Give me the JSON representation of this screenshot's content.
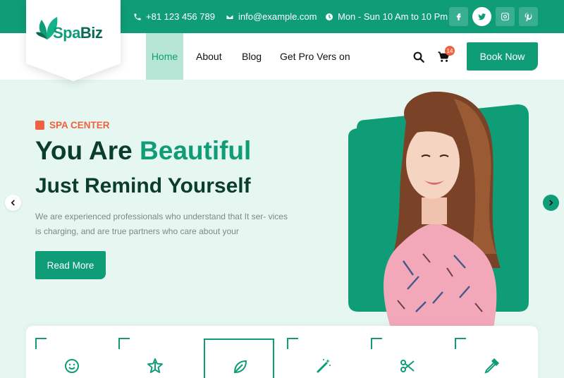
{
  "topbar": {
    "phone": "+81 123 456 789",
    "email": "info@example.com",
    "hours": "Mon - Sun 10 Am to 10 Pm",
    "social": [
      "facebook-icon",
      "twitter-icon",
      "instagram-icon",
      "pinterest-icon"
    ]
  },
  "logo": {
    "part1": "Spa",
    "part2": "Biz"
  },
  "nav": {
    "items": [
      {
        "label": "Home",
        "active": true
      },
      {
        "label": "About"
      },
      {
        "label": "Blog"
      },
      {
        "label": "Get Pro Vers on"
      }
    ],
    "cart_count": "14",
    "book_label": "Book Now"
  },
  "hero": {
    "eyebrow": "SPA CENTER",
    "title_plain": "You Are ",
    "title_accent": "Beautiful",
    "subtitle": "Just Remind Yourself",
    "description": "We are experienced professionals who understand that It ser- vices is charging, and are true partners who care about your",
    "button_label": "Read More"
  },
  "features": [
    "smile-icon",
    "star-icon",
    "leaf-icon",
    "magic-wand-icon",
    "scissors-icon",
    "dropper-icon"
  ],
  "colors": {
    "primary": "#0f9d78",
    "dark": "#0b3d2f",
    "accent": "#f0623f",
    "hero_bg": "#e6f6f1"
  }
}
